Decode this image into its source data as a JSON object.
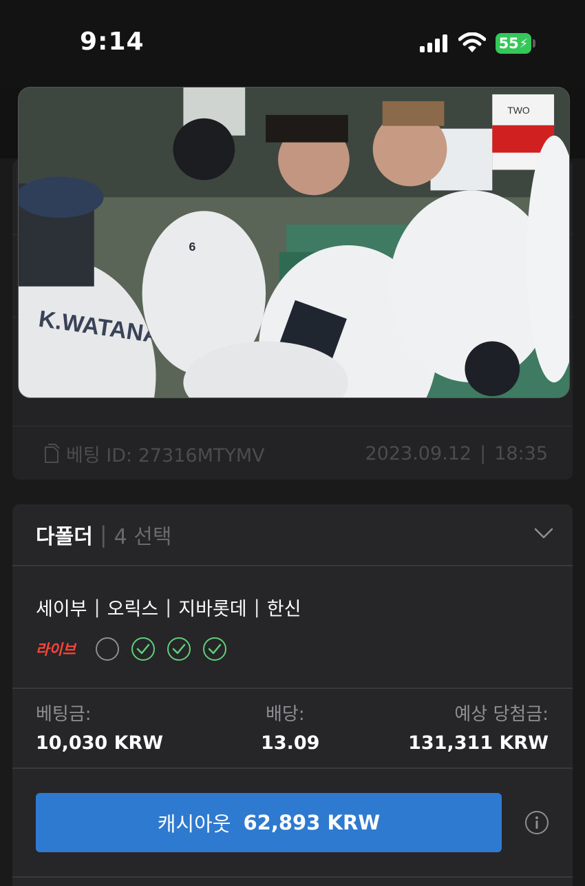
{
  "status_bar": {
    "time": "9:14",
    "battery": "55",
    "icons": [
      "signal-icon",
      "wifi-icon",
      "battery-icon"
    ]
  },
  "video": {
    "jersey_text": "K.WATANABE",
    "jersey_number": "6",
    "banner_text": "TWO"
  },
  "ticket": {
    "id_label": "베팅 ID: 27316MTYMV",
    "date": "2023.09.12",
    "date_sep": "|",
    "time": "18:35"
  },
  "bet": {
    "type": "다폴더",
    "separator": "|",
    "count": "4 선택",
    "teams": [
      "세이부",
      "오릭스",
      "지바롯데",
      "한신"
    ],
    "team_separator": "|",
    "live_label": "라이브",
    "legs": [
      "pending",
      "won",
      "won",
      "won"
    ],
    "stake_label": "베팅금:",
    "stake_value": "10,030 KRW",
    "odds_label": "배당:",
    "odds_value": "13.09",
    "payout_label": "예상 당첨금:",
    "payout_value": "131,311 KRW",
    "cashout_label": "캐시아웃",
    "cashout_amount": "62,893 KRW"
  },
  "colors": {
    "accent": "#2f7ad1",
    "live": "#ff453a",
    "won": "#34c759",
    "background": "#1c1c1e"
  }
}
